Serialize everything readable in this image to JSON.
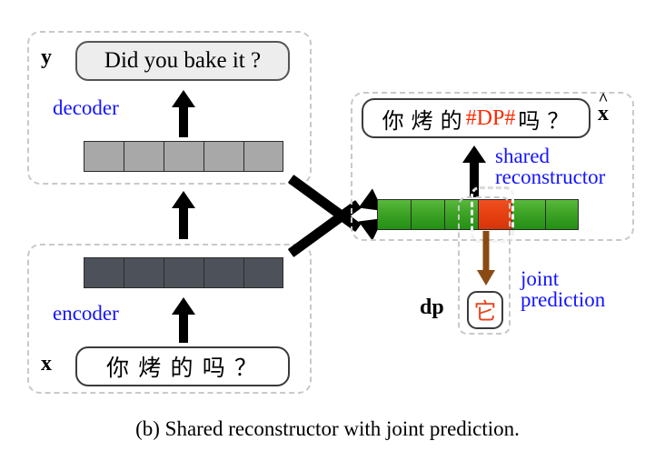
{
  "figure": {
    "caption": "(b) Shared reconstructor with joint prediction."
  },
  "decoder_panel": {
    "var_label": "y",
    "sentence": "Did you bake it ?",
    "module_label": "decoder",
    "cell_count": 5,
    "cell_color": "#a8a8a8"
  },
  "encoder_panel": {
    "var_label": "x",
    "sentence": "你 烤 的 吗 ？",
    "module_label": "encoder",
    "cell_count": 5,
    "cell_color": "#4d525a"
  },
  "reconstructor_panel": {
    "var_label_base": "x",
    "var_label_accent": "^",
    "sentence_prefix": "你 烤 的 ",
    "sentence_token": "#DP#",
    "sentence_suffix": " 吗 ？",
    "module_label_line1": "shared",
    "module_label_line2": "reconstructor",
    "cells": [
      {
        "color": "#3ea326",
        "type": "green"
      },
      {
        "color": "#3ea326",
        "type": "green"
      },
      {
        "color": "#3ea326",
        "type": "green"
      },
      {
        "color": "#e5400f",
        "type": "red"
      },
      {
        "color": "#3ea326",
        "type": "green"
      },
      {
        "color": "#3ea326",
        "type": "green"
      }
    ]
  },
  "joint_prediction": {
    "var_label": "dp",
    "token": "它",
    "label_line1": "joint",
    "label_line2": "prediction",
    "arrow_color": "#8a4b12",
    "token_color": "#ff2a00"
  },
  "colors": {
    "accent_blue": "#1414ff",
    "dp_red": "#ff2a00",
    "panel_dash": "#c9c9c9"
  }
}
